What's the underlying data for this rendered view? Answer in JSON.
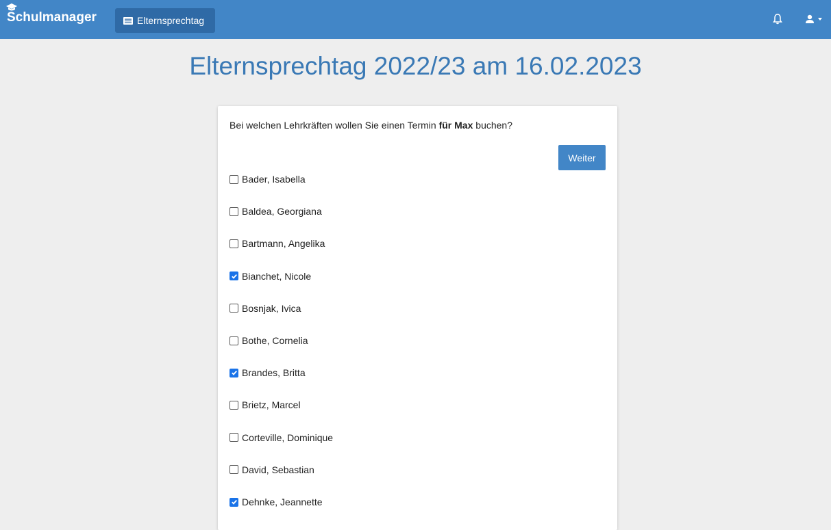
{
  "navbar": {
    "brand": "Schulmanager",
    "active_item": "Elternsprechtag"
  },
  "page": {
    "title": "Elternsprechtag 2022/23 am 16.02.2023"
  },
  "form": {
    "question_prefix": "Bei welchen Lehrkräften wollen Sie einen Termin ",
    "question_bold": "für Max",
    "question_suffix": " buchen?",
    "weiter_label": "Weiter"
  },
  "teachers": [
    {
      "name": "Bader, Isabella",
      "checked": false
    },
    {
      "name": "Baldea, Georgiana",
      "checked": false
    },
    {
      "name": "Bartmann, Angelika",
      "checked": false
    },
    {
      "name": "Bianchet, Nicole",
      "checked": true
    },
    {
      "name": "Bosnjak, Ivica",
      "checked": false
    },
    {
      "name": "Bothe, Cornelia",
      "checked": false
    },
    {
      "name": "Brandes, Britta",
      "checked": true
    },
    {
      "name": "Brietz, Marcel",
      "checked": false
    },
    {
      "name": "Corteville, Dominique",
      "checked": false
    },
    {
      "name": "David, Sebastian",
      "checked": false
    },
    {
      "name": "Dehnke, Jeannette",
      "checked": true
    }
  ],
  "colors": {
    "navbar": "#4286c7",
    "accent": "#3a79b5",
    "checkbox_checked": "#1a73e8"
  }
}
